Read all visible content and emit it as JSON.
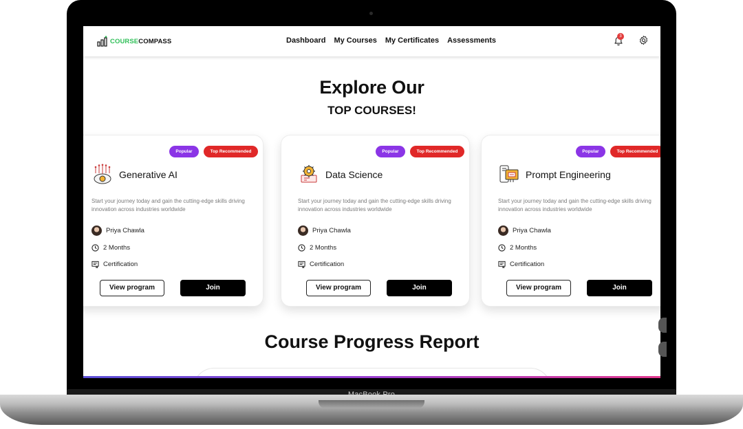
{
  "device": {
    "label": "MacBook Pro"
  },
  "navbar": {
    "logo": {
      "part1": "COURSE",
      "part2": "COMPASS"
    },
    "links": [
      "Dashboard",
      "My Courses",
      "My Certificates",
      "Assessments"
    ],
    "notification_count": "3",
    "icons": [
      "bell-icon",
      "gear-icon"
    ]
  },
  "hero": {
    "title": "Explore Our",
    "subtitle": "TOP COURSES!"
  },
  "courses": [
    {
      "tags": [
        "Popular",
        "Top Recommended"
      ],
      "icon": "ai-brain-icon",
      "title": "Generative AI",
      "description": "Start your journey today and gain the cutting-edge skills driving innovation across industries worldwide",
      "author": "Priya Chawla",
      "duration": "2 Months",
      "credential": "Certification",
      "view_label": "View program",
      "join_label": "Join"
    },
    {
      "tags": [
        "Popular",
        "Top Recommended"
      ],
      "icon": "data-science-icon",
      "title": "Data Science",
      "description": "Start your journey today and gain the cutting-edge skills driving innovation across industries worldwide",
      "author": "Priya Chawla",
      "duration": "2 Months",
      "credential": "Certification",
      "view_label": "View program",
      "join_label": "Join"
    },
    {
      "tags": [
        "Popular",
        "Top Recommended"
      ],
      "icon": "prompt-engineering-icon",
      "title": "Prompt Engineering",
      "description": "Start your journey today and gain the cutting-edge skills driving innovation across industries worldwide",
      "author": "Priya Chawla",
      "duration": "2 Months",
      "credential": "Certification",
      "view_label": "View program",
      "join_label": "Join"
    }
  ],
  "progress": {
    "title": "Course Progress Report"
  },
  "colors": {
    "brand_green": "#2fbf58",
    "popular_tag": "#8b35e6",
    "recommended_tag": "#e02828",
    "join_button": "#000000"
  }
}
